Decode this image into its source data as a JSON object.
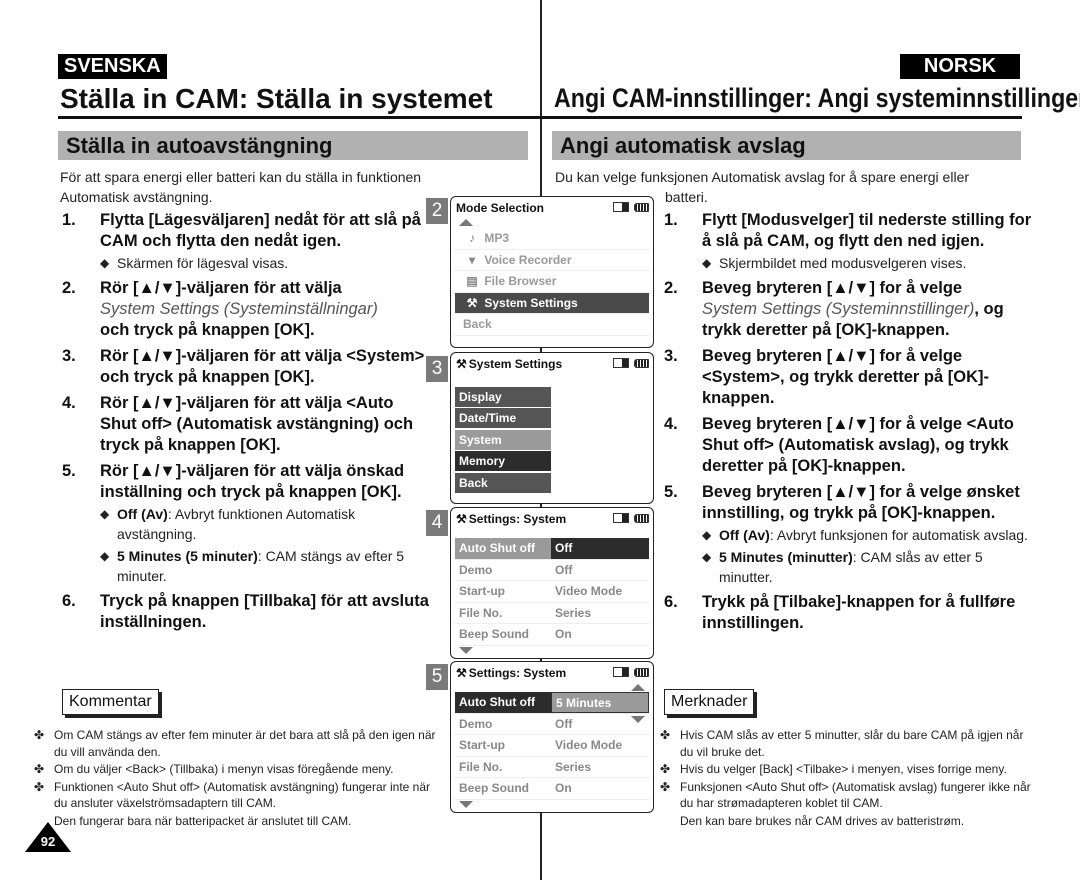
{
  "left": {
    "language": "SVENSKA",
    "title": "Ställa in CAM: Ställa in systemet",
    "section": "Ställa in autoavstängning",
    "intro": "För att spara energi eller batteri kan du ställa in funktionen Automatisk avstängning.",
    "steps": [
      {
        "num": "1.",
        "text": "Flytta [Lägesväljaren] nedåt för att slå på CAM och flytta den nedåt igen.",
        "subs": [
          "Skärmen för lägesval visas."
        ]
      },
      {
        "num": "2.",
        "pre": "Rör [▲/▼]-väljaren för att välja",
        "italic": "System Settings (Systeminställningar)",
        "post": "och tryck på knappen [OK]."
      },
      {
        "num": "3.",
        "text": "Rör [▲/▼]-väljaren för att välja <System> och tryck på knappen [OK]."
      },
      {
        "num": "4.",
        "text": "Rör [▲/▼]-väljaren för att välja <Auto Shut off> (Automatisk avstängning) och tryck på knappen [OK]."
      },
      {
        "num": "5.",
        "text": "Rör [▲/▼]-väljaren för att välja önskad inställning och tryck på knappen [OK].",
        "options": [
          {
            "bold": "Off (Av)",
            "text": ": Avbryt funktionen Automatisk avstängning."
          },
          {
            "bold": "5 Minutes (5 minuter)",
            "text": ": CAM stängs av efter 5 minuter."
          }
        ]
      },
      {
        "num": "6.",
        "text": "Tryck på knappen [Tillbaka] för att avsluta inställningen."
      }
    ],
    "notes_title": "Kommentar",
    "notes": [
      "Om CAM stängs av efter fem minuter är det bara att slå på den igen när du vill använda den.",
      "Om du väljer <Back> (Tillbaka) i menyn visas föregående meny.",
      "Funktionen <Auto Shut off> (Automatisk avstängning) fungerar inte när du ansluter växelströmsadaptern till CAM."
    ],
    "notes_cont": "Den fungerar bara när batteripacket är anslutet till CAM.",
    "page_number": "92"
  },
  "right": {
    "language": "NORSK",
    "title": "Angi CAM-innstillinger: Angi systeminnstillinger",
    "section": "Angi automatisk avslag",
    "intro_a": "Du kan velge funksjonen Automatisk avslag for å spare energi eller",
    "intro_b": "batteri.",
    "steps": [
      {
        "num": "1.",
        "text": "Flytt [Modusvelger] til nederste stilling for å slå på CAM, og flytt den ned igjen.",
        "subs": [
          "Skjermbildet med modusvelgeren vises."
        ]
      },
      {
        "num": "2.",
        "pre": "Beveg bryteren [▲/▼] for å velge",
        "italic": "System Settings (Systeminnstillinger)",
        "post": ", og trykk deretter på [OK]-knappen."
      },
      {
        "num": "3.",
        "text": "Beveg bryteren [▲/▼] for å velge <System>, og trykk deretter på [OK]-knappen."
      },
      {
        "num": "4.",
        "text": "Beveg bryteren [▲/▼] for å velge <Auto Shut off> (Automatisk avslag), og trykk deretter på [OK]-knappen."
      },
      {
        "num": "5.",
        "text": "Beveg bryteren [▲/▼] for å velge ønsket innstilling, og trykk på [OK]-knappen.",
        "options": [
          {
            "bold": "Off (Av)",
            "text": ": Avbryt funksjonen for automatisk avslag."
          },
          {
            "bold": "5 Minutes (minutter)",
            "text": ": CAM slås av etter 5 minutter."
          }
        ]
      },
      {
        "num": "6.",
        "text": "Trykk på [Tilbake]-knappen for å fullføre innstillingen."
      }
    ],
    "notes_title": "Merknader",
    "notes": [
      "Hvis CAM slås av etter 5 minutter, slår du bare CAM på igjen når du vil bruke det.",
      "Hvis du velger [Back] <Tilbake> i menyen, vises forrige meny.",
      "Funksjonen <Auto Shut off> (Automatisk avslag) fungerer ikke når du har strømadapteren koblet til CAM."
    ],
    "notes_cont": "Den kan bare brukes når CAM drives av batteristrøm."
  },
  "screens": {
    "s2": {
      "num": "2",
      "title": "Mode Selection",
      "items": [
        {
          "icon": "♪",
          "label": "MP3"
        },
        {
          "icon": "🎙",
          "label": "Voice Recorder"
        },
        {
          "icon": "▤",
          "label": "File Browser"
        },
        {
          "icon": "⚒",
          "label": "System Settings",
          "selected": true
        },
        {
          "icon": "",
          "label": "Back"
        }
      ]
    },
    "s3": {
      "num": "3",
      "title": "System Settings",
      "items": [
        "Display",
        "Date/Time",
        "System",
        "Memory",
        "Back"
      ],
      "highlighted": "System",
      "focused": "Memory"
    },
    "s4": {
      "num": "4",
      "title": "Settings: System",
      "rows": [
        {
          "k": "Auto Shut off",
          "v": "Off"
        },
        {
          "k": "Demo",
          "v": "Off"
        },
        {
          "k": "Start-up",
          "v": "Video Mode"
        },
        {
          "k": "File No.",
          "v": "Series"
        },
        {
          "k": "Beep Sound",
          "v": "On"
        }
      ]
    },
    "s5": {
      "num": "5",
      "title": "Settings: System",
      "rows": [
        {
          "k": "Auto Shut off",
          "v": "5 Minutes"
        },
        {
          "k": "Demo",
          "v": "Off"
        },
        {
          "k": "Start-up",
          "v": "Video Mode"
        },
        {
          "k": "File No.",
          "v": "Series"
        },
        {
          "k": "Beep Sound",
          "v": "On"
        }
      ]
    },
    "tools_icon": "⚒",
    "bullet": "◆",
    "note_bullet": "✤"
  }
}
